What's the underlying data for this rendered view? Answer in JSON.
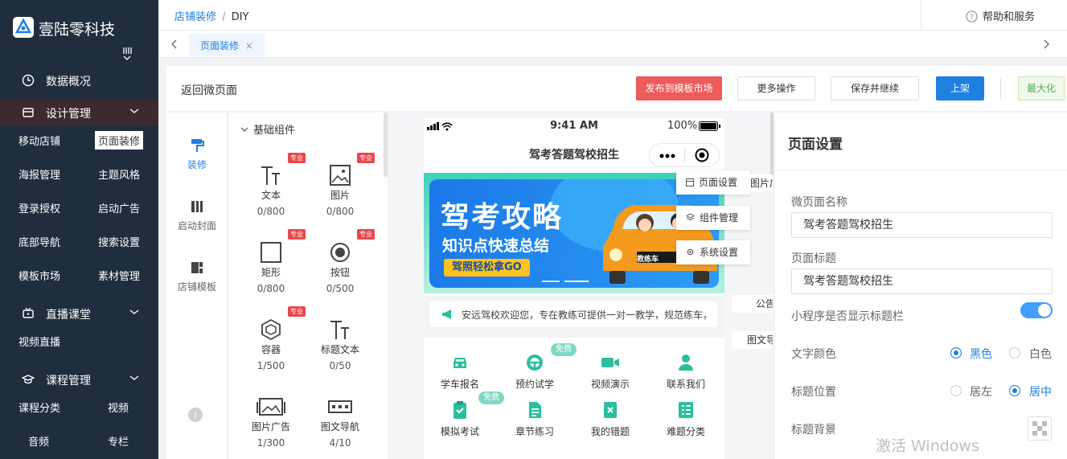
{
  "sidebar": {
    "logo": "壹陆零科技",
    "menus": [
      {
        "label": "数据概况"
      },
      {
        "label": "设计管理"
      },
      {
        "label": "直播课堂"
      },
      {
        "label": "课程管理"
      }
    ],
    "sub_design": [
      "移动店铺",
      "页面装修",
      "海报管理",
      "主题风格",
      "登录授权",
      "启动广告",
      "底部导航",
      "搜索设置",
      "模板市场",
      "素材管理"
    ],
    "sub_live": [
      "视频直播"
    ],
    "sub_course": [
      "课程分类",
      "视频",
      "音频",
      "专栏"
    ]
  },
  "topbar": {
    "crumb_parent": "店铺装修",
    "crumb_sep": "/",
    "crumb_current": "DIY",
    "help": "帮助和服务"
  },
  "tabs": [
    {
      "label": "页面装修"
    }
  ],
  "actions": {
    "back": "返回微页面",
    "publish": "发布到模板市场",
    "more": "更多操作",
    "save_continue": "保存并继续",
    "shelve": "上架",
    "maximize": "最大化"
  },
  "tools": [
    "装修",
    "启动封面",
    "店铺模板"
  ],
  "components": {
    "group_title": "基础组件",
    "badge": "专业",
    "items": [
      {
        "label": "文本",
        "count": "0/800",
        "pro": true
      },
      {
        "label": "图片",
        "count": "0/800",
        "pro": true
      },
      {
        "label": "矩形",
        "count": "0/800",
        "pro": true
      },
      {
        "label": "按钮",
        "count": "0/500",
        "pro": true
      },
      {
        "label": "容器",
        "count": "1/500",
        "pro": true
      },
      {
        "label": "标题文本",
        "count": "0/50",
        "pro": false
      },
      {
        "label": "图片广告",
        "count": "1/300",
        "pro": false
      },
      {
        "label": "图文导航",
        "count": "4/10",
        "pro": false
      }
    ]
  },
  "phone": {
    "time": "9:41 AM",
    "battery": "100%",
    "title": "驾考答题驾校招生",
    "banner_title": "驾考攻略",
    "banner_sub": "知识点快速总结",
    "banner_tag": "驾照轻松拿GO",
    "banner_car": "教练车",
    "notice": "安远驾校欢迎您，专在教练可提供一对一教学，规范练车，",
    "free_badge": "免费",
    "nav_row1": [
      "学车报名",
      "预约试学",
      "视频演示",
      "联系我们"
    ],
    "nav_row2": [
      "模拟考试",
      "章节练习",
      "我的错题",
      "难题分类"
    ]
  },
  "floating": {
    "page_settings": "页面设置",
    "component_mgmt": "组件管理",
    "system_settings": "系统设置"
  },
  "side_tags": [
    "图片广",
    "公告",
    "图文导"
  ],
  "right_panel": {
    "title": "页面设置",
    "name_label": "微页面名称",
    "name_value": "驾考答题驾校招生",
    "page_title_label": "页面标题",
    "page_title_value": "驾考答题驾校招生",
    "show_titlebar_label": "小程序是否显示标题栏",
    "show_titlebar": true,
    "text_color_label": "文字颜色",
    "text_color_options": [
      "黑色",
      "白色"
    ],
    "text_color_selected": "黑色",
    "title_pos_label": "标题位置",
    "title_pos_options": [
      "居左",
      "居中"
    ],
    "title_pos_selected": "居中",
    "title_bg_label": "标题背景"
  },
  "watermark": "激活 Windows",
  "colors": {
    "sidebar": "#1f2d3d",
    "primary": "#1e80e0",
    "danger": "#ee5b5b",
    "success": "#4caf50",
    "teal": "#2bbf9e"
  }
}
